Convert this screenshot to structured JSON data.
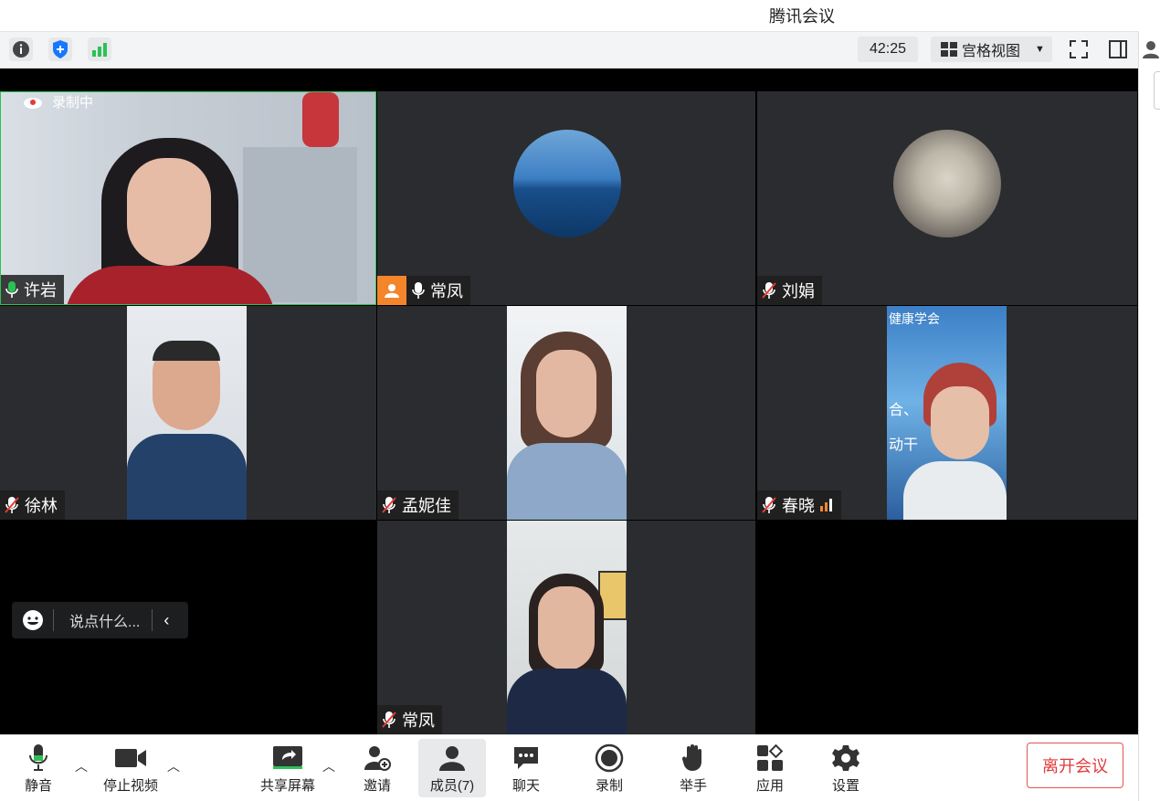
{
  "window": {
    "title": "腾讯会议"
  },
  "topbar": {
    "timer": "42:25",
    "view_label": "宫格视图"
  },
  "recording_badge": "录制中",
  "tiles": [
    {
      "name": "许岩",
      "mic": "on"
    },
    {
      "name": "常凤",
      "mic": "on",
      "host": true
    },
    {
      "name": "刘娟",
      "mic": "muted"
    },
    {
      "name": "徐林",
      "mic": "muted"
    },
    {
      "name": "孟妮佳",
      "mic": "muted"
    },
    {
      "name": "春晓",
      "mic": "muted",
      "video_text_1": "健康学会",
      "video_text_2": "合、",
      "video_text_3": "动干"
    },
    {
      "name": "常凤",
      "mic": "muted"
    }
  ],
  "chat": {
    "placeholder": "说点什么..."
  },
  "bottombar": {
    "mute": "静音",
    "stop_video": "停止视频",
    "share_screen": "共享屏幕",
    "invite": "邀请",
    "members": "成员(7)",
    "chat": "聊天",
    "record": "录制",
    "raise_hand": "举手",
    "apps": "应用",
    "settings": "设置",
    "leave": "离开会议"
  },
  "colors": {
    "leave_red": "#e03a3a",
    "mic_green": "#2bc255",
    "host_orange": "#f5852a"
  }
}
